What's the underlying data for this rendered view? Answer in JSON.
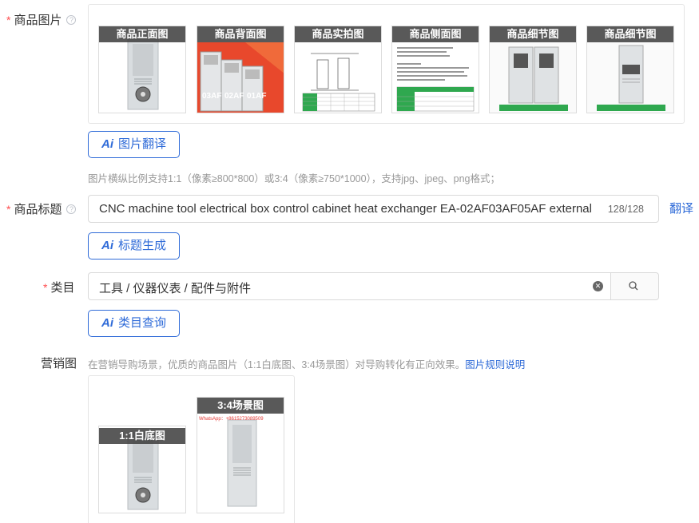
{
  "images_row": {
    "label": "商品图片",
    "required_mark": "*",
    "help_icon": "?",
    "thumbs": [
      {
        "label": "商品正面图"
      },
      {
        "label": "商品背面图"
      },
      {
        "label": "商品实拍图"
      },
      {
        "label": "商品侧面图"
      },
      {
        "label": "商品细节图"
      },
      {
        "label": "商品细节图"
      }
    ],
    "translate_button": "图片翻译",
    "hint": "图片横纵比例支持1:1（像素≥800*800）或3:4（像素≥750*1000），支持jpg、jpeg、png格式；"
  },
  "title_row": {
    "label": "商品标题",
    "required_mark": "*",
    "help_icon": "?",
    "value": "CNC machine tool electrical box control cabinet heat exchanger EA-02AF03AF05AF external",
    "counter": "128/128",
    "translate_link": "翻译",
    "generate_button": "标题生成"
  },
  "category_row": {
    "label": "类目",
    "required_mark": "*",
    "value": "工具 / 仪器仪表 / 配件与附件",
    "query_button": "类目查询"
  },
  "marketing_row": {
    "label": "营销图",
    "hint": "在营销导购场景，优质的商品图片（1:1白底图、3:4场景图）对导购转化有正向效果。",
    "rules_link": "图片规则说明",
    "thumbs": [
      {
        "label": "1:1白底图"
      },
      {
        "label": "3:4场景图"
      }
    ]
  },
  "ai_mark": "Ai",
  "thumb_texts": {
    "model_03": "03AF",
    "model_02": "02AF",
    "model_01": "01AF",
    "whatsapp": "WhatsApp：+8615273089509"
  },
  "colors": {
    "accent": "#2f6bd8",
    "required": "#ff4d4f",
    "border": "#d9d9d9",
    "hint": "#999999",
    "thumb_red": "#e8482c",
    "thumb_green": "#2fa84f"
  }
}
